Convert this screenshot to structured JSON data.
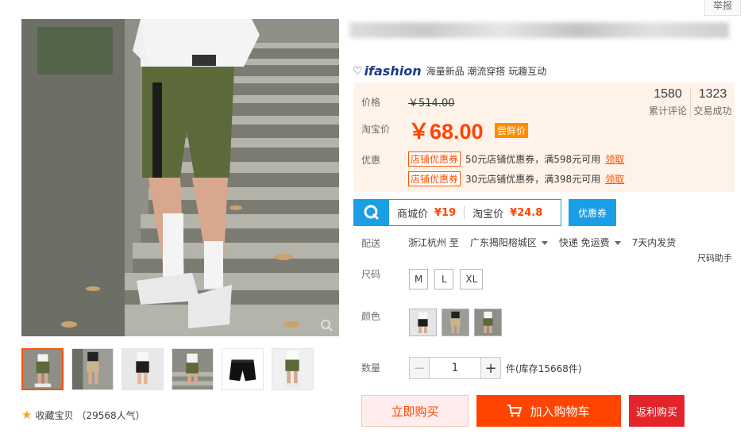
{
  "header": {
    "report_label": "举报"
  },
  "gallery": {
    "thumbnail_count": 6,
    "favorite_label": "收藏宝贝",
    "favorite_count": "（29568人气）"
  },
  "product": {
    "brand_name": "ifashion",
    "brand_slogan": "海量新品 潮流穿搭 玩趣互动"
  },
  "price": {
    "price_label": "价格",
    "original_price": "￥514.00",
    "promo_label": "淘宝价",
    "promo_price": "￥68.00",
    "promo_tag": "尝鲜价",
    "reviews_count": "1580",
    "reviews_label": "累计评论",
    "sales_count": "1323",
    "sales_label": "交易成功",
    "discount_label": "优惠",
    "coupons": [
      {
        "tag": "店铺优惠券",
        "text": "50元店铺优惠券，满598元可用",
        "link": "领取"
      },
      {
        "tag": "店铺优惠券",
        "text": "30元店铺优惠券，满398元可用",
        "link": "领取"
      }
    ]
  },
  "mall_compare": {
    "mall_label": "商城价",
    "mall_price": "¥19",
    "taobao_label": "淘宝价",
    "taobao_price": "¥24.8",
    "coupon_button": "优惠券"
  },
  "delivery": {
    "label": "配送",
    "from": "浙江杭州 至",
    "to": "广东揭阳榕城区",
    "shipping": "快递 免运费",
    "ship_time": "7天内发货"
  },
  "size": {
    "helper": "尺码助手",
    "label": "尺码",
    "options": [
      "M",
      "L",
      "XL"
    ]
  },
  "color": {
    "label": "颜色",
    "option_count": 3
  },
  "quantity": {
    "label": "数量",
    "value": "1",
    "minus": "−",
    "plus": "+",
    "stock": "件(库存15668件)"
  },
  "actions": {
    "buy_now": "立即购买",
    "add_cart": "加入购物车",
    "rebate": "返利购买"
  },
  "colors": {
    "accent": "#ff4400",
    "price_bg": "#fff2e8",
    "mall_blue": "#1a9ee6",
    "rebate_red": "#e4242b"
  }
}
